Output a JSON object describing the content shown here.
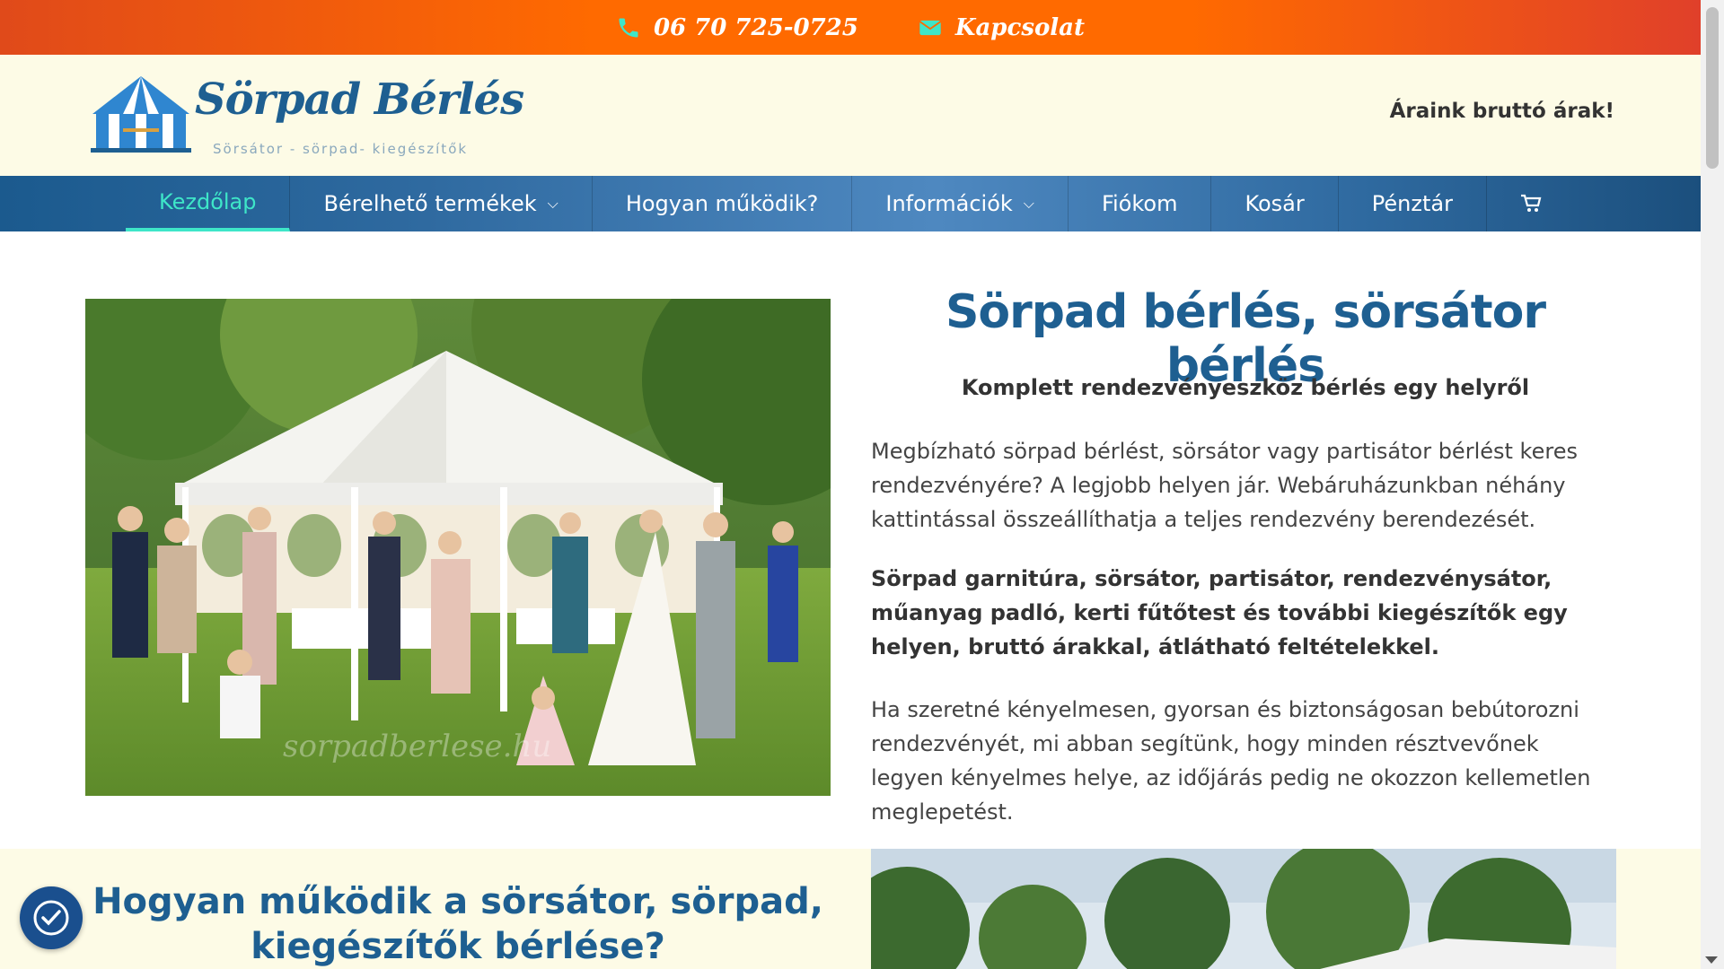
{
  "topbar": {
    "phone": "06 70 725-0725",
    "contact": "Kapcsolat",
    "phone_icon": "phone-icon",
    "mail_icon": "envelope-icon",
    "icon_color": "#3ee6c8"
  },
  "header": {
    "logo_title": "Sörpad Bérlés",
    "logo_sub": "Sörsátor - sörpad- kiegészítők",
    "prices_note": "Áraink bruttó árak!"
  },
  "nav": {
    "items": [
      {
        "label": "Kezdőlap",
        "active": true
      },
      {
        "label": "Bérelhető termékek",
        "dropdown": true
      },
      {
        "label": "Hogyan működik?"
      },
      {
        "label": "Információk",
        "dropdown": true
      },
      {
        "label": "Fiókom"
      },
      {
        "label": "Kosár"
      },
      {
        "label": "Pénztár"
      }
    ],
    "cart_icon": "cart-icon"
  },
  "hero": {
    "title": "Sörpad bérlés, sörsátor bérlés",
    "subtitle": "Komplett rendezvényeszköz bérlés egy helyről",
    "p1": "Megbízható sörpad bérlést, sörsátor vagy partisátor bérlést keres rendezvényére? A legjobb helyen jár. Webáruházunkban néhány kattintással összeállíthatja a teljes rendezvény berendezését.",
    "p2": "Sörpad garnitúra, sörsátor, partisátor, rendezvénysátor, műanyag padló, kerti fűtőtest és további kiegészítők egy helyen, bruttó árakkal, átlátható feltételekkel.",
    "p3": "Ha szeretné kényelmesen, gyorsan és biztonságosan bebútorozni rendezvényét, mi abban segítünk, hogy minden résztvevőnek legyen kényelmes helye, az időjárás pedig ne okozzon kellemetlen meglepetést.",
    "image_watermark": "sorpadberlese.hu"
  },
  "section2": {
    "title": "Hogyan működik a sörsátor, sörpad, kiegészítők bérlése?"
  },
  "colors": {
    "brand_blue": "#1e5f91",
    "accent_orange": "#ff6a00",
    "cream": "#fdfbe6"
  }
}
